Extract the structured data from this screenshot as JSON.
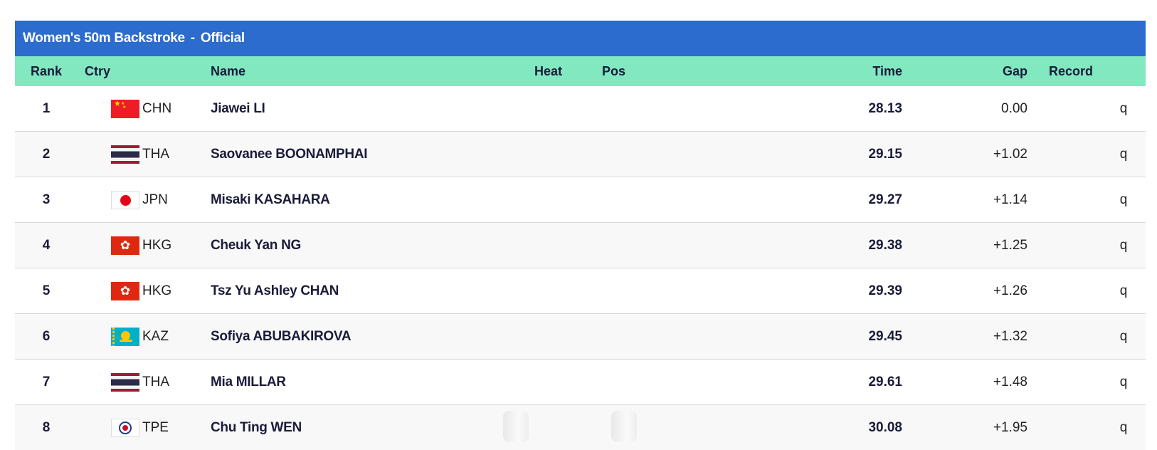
{
  "title": {
    "event": "Women's 50m Backstroke",
    "separator": "-",
    "status": "Official"
  },
  "header": {
    "rank": "Rank",
    "ctry": "Ctry",
    "name": "Name",
    "heat": "Heat",
    "pos": "Pos",
    "time": "Time",
    "gap": "Gap",
    "record": "Record"
  },
  "rows": [
    {
      "rank": "1",
      "ctry": "CHN",
      "flag": "china-flag-icon",
      "name": "Jiawei LI",
      "time": "28.13",
      "gap": "0.00",
      "q": "q"
    },
    {
      "rank": "2",
      "ctry": "THA",
      "flag": "thailand-flag-icon",
      "name": "Saovanee BOONAMPHAI",
      "time": "29.15",
      "gap": "+1.02",
      "q": "q"
    },
    {
      "rank": "3",
      "ctry": "JPN",
      "flag": "japan-flag-icon",
      "name": "Misaki KASAHARA",
      "time": "29.27",
      "gap": "+1.14",
      "q": "q"
    },
    {
      "rank": "4",
      "ctry": "HKG",
      "flag": "hong-kong-flag-icon",
      "name": "Cheuk Yan NG",
      "time": "29.38",
      "gap": "+1.25",
      "q": "q"
    },
    {
      "rank": "5",
      "ctry": "HKG",
      "flag": "hong-kong-flag-icon",
      "name": "Tsz Yu Ashley CHAN",
      "time": "29.39",
      "gap": "+1.26",
      "q": "q"
    },
    {
      "rank": "6",
      "ctry": "KAZ",
      "flag": "kazakhstan-flag-icon",
      "name": "Sofiya ABUBAKIROVA",
      "time": "29.45",
      "gap": "+1.32",
      "q": "q"
    },
    {
      "rank": "7",
      "ctry": "THA",
      "flag": "thailand-flag-icon",
      "name": "Mia MILLAR",
      "time": "29.61",
      "gap": "+1.48",
      "q": "q"
    },
    {
      "rank": "8",
      "ctry": "TPE",
      "flag": "chinese-taipei-flag-icon",
      "name": "Chu Ting WEN",
      "time": "30.08",
      "gap": "+1.95",
      "q": "q"
    }
  ],
  "colors": {
    "title_bar": "#2b6cce",
    "header_row": "#81e8c0",
    "text": "#1b1b3a"
  }
}
